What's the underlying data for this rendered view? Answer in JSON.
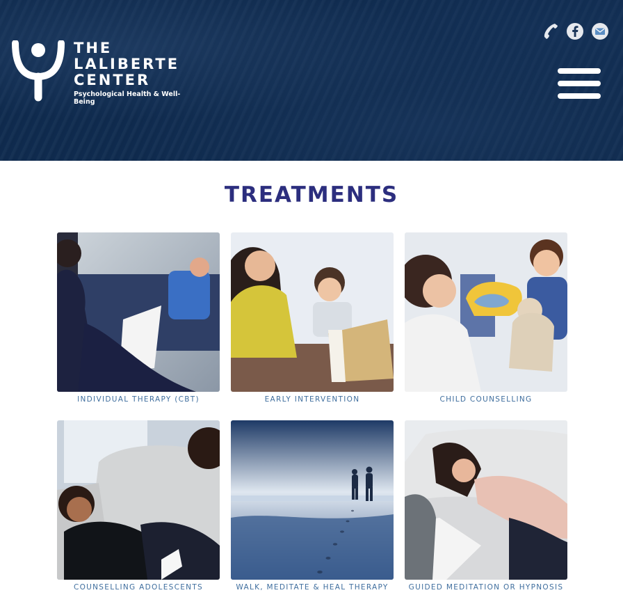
{
  "brand": {
    "line1": "THE",
    "line2": "LALIBERTE",
    "line3": "CENTER",
    "tagline": "Psychological Health & Well-Being"
  },
  "social": [
    {
      "name": "phone-icon"
    },
    {
      "name": "facebook-icon"
    },
    {
      "name": "mail-icon"
    }
  ],
  "section_title": "TREATMENTS",
  "treatments": [
    {
      "label": "INDIVIDUAL THERAPY (CBT)"
    },
    {
      "label": "EARLY INTERVENTION"
    },
    {
      "label": "CHILD COUNSELLING"
    },
    {
      "label": "COUNSELLING ADOLESCENTS"
    },
    {
      "label": "WALK, MEDITATE & HEAL THERAPY"
    },
    {
      "label": "GUIDED MEDITATION OR HYPNOSIS"
    }
  ],
  "colors": {
    "header_bg": "#0f2b4f",
    "title": "#2c2e7e",
    "caption": "#3f6e9e"
  }
}
